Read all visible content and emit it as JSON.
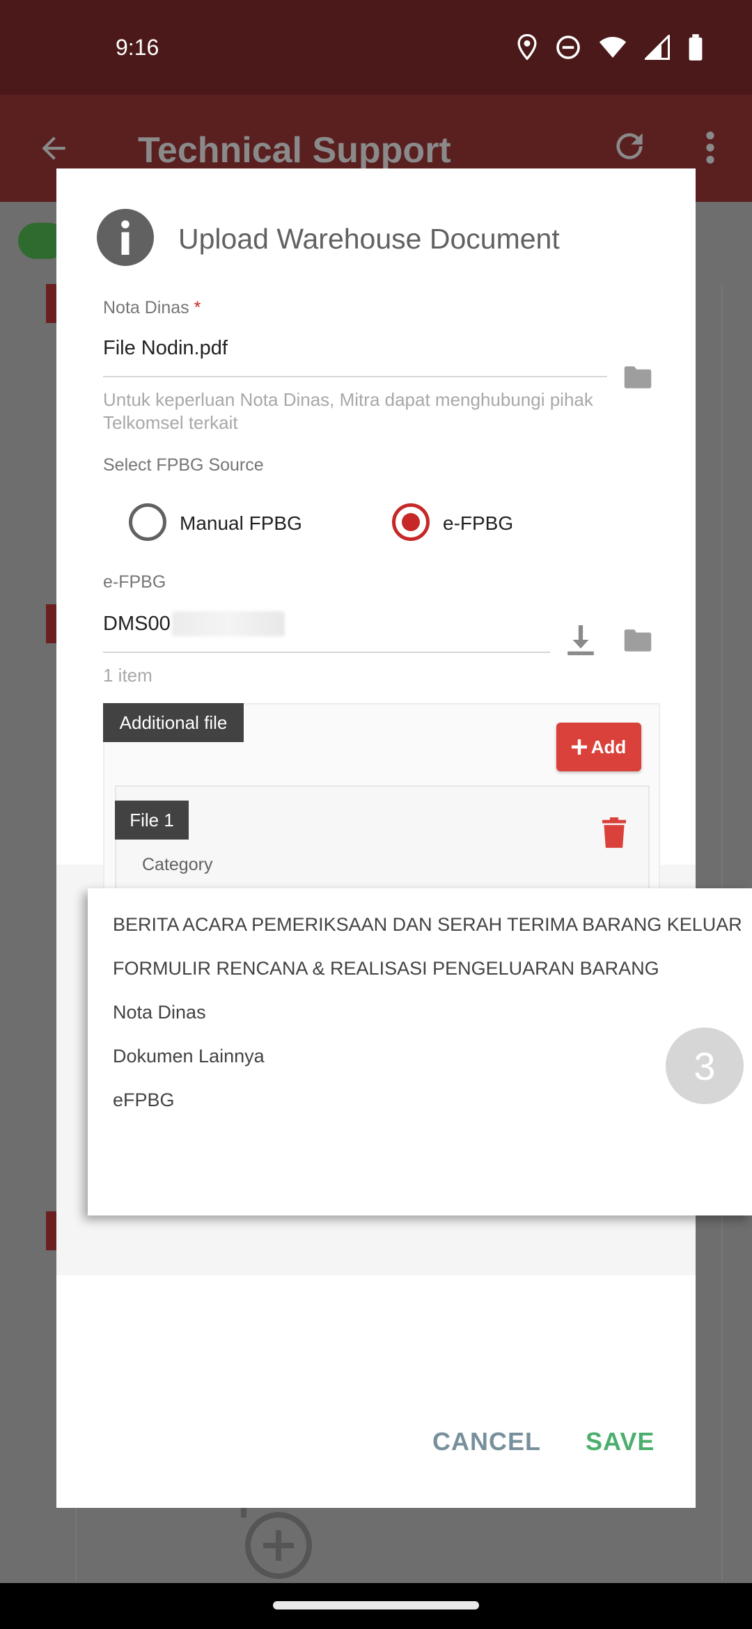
{
  "status_bar": {
    "time": "9:16",
    "icons": [
      "location-icon",
      "do-not-disturb-icon",
      "wifi-icon",
      "signal-icon",
      "battery-icon"
    ]
  },
  "app_bar": {
    "title": "Technical Support",
    "back_icon": "arrow-back-icon",
    "refresh_icon": "refresh-icon",
    "more_icon": "more-vert-icon"
  },
  "dialog": {
    "title": "Upload Warehouse Document",
    "nota_dinas": {
      "label": "Nota Dinas",
      "required_mark": "*",
      "value": "File Nodin.pdf",
      "hint": "Untuk keperluan Nota Dinas, Mitra dapat menghubungi pihak Telkomsel terkait"
    },
    "fpbg_source": {
      "label": "Select FPBG Source",
      "options": [
        "Manual FPBG",
        "e-FPBG"
      ],
      "selected": "e-FPBG"
    },
    "efpbg": {
      "label": "e-FPBG",
      "value": "DMS00",
      "count": "1 item"
    },
    "additional_file": {
      "label": "Additional file",
      "add_label": "Add",
      "file_label": "File 1",
      "category_label": "Category"
    },
    "cancel_label": "CANCEL",
    "save_label": "SAVE"
  },
  "dropdown": {
    "items": [
      "BERITA ACARA PEMERIKSAAN DAN SERAH TERIMA BARANG KELUAR",
      "FORMULIR RENCANA & REALISASI PENGELUARAN BARANG",
      "Nota Dinas",
      "Dokumen Lainnya",
      "eFPBG"
    ]
  },
  "badge": "3",
  "colors": {
    "accent": "#c62828",
    "add_button": "#d9413a",
    "save": "#4caf6e",
    "cancel": "#78909c",
    "status_bar": "#4b1919"
  }
}
